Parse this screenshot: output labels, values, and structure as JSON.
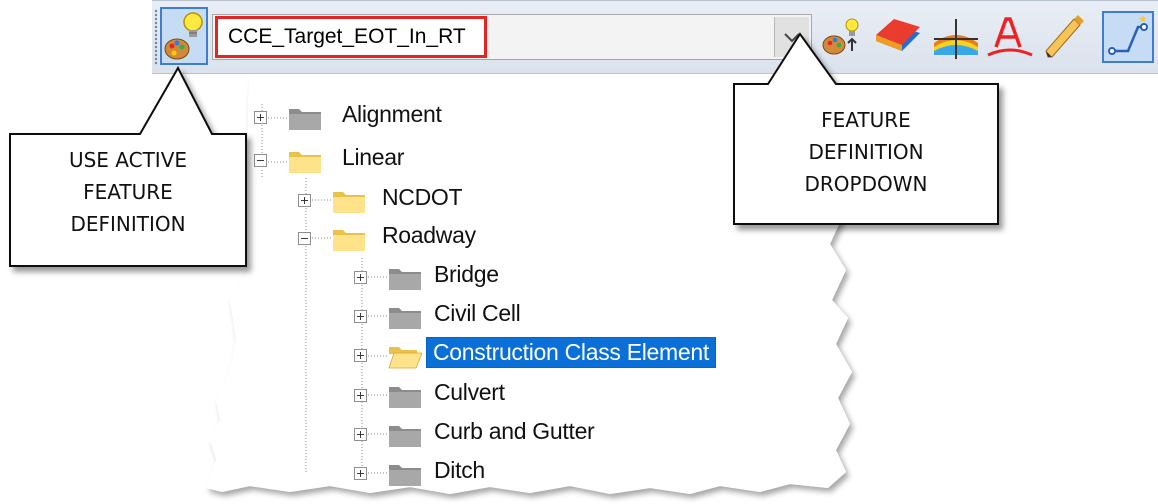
{
  "toolbar": {
    "feature_definition_value": "CCE_Target_EOT_In_RT",
    "icons": [
      "use-active-feature-icon",
      "dropdown-arrow-icon",
      "feature-settings-icon",
      "surface-icon",
      "cross-section-icon",
      "text-annotation-icon",
      "pencil-icon",
      "element-select-icon"
    ]
  },
  "tree": {
    "items": [
      {
        "label": "Alignment",
        "level": 0,
        "expanded": false,
        "folder": "gray"
      },
      {
        "label": "Linear",
        "level": 0,
        "expanded": true,
        "folder": "yellow"
      },
      {
        "label": "NCDOT",
        "level": 1,
        "expanded": false,
        "folder": "yellow"
      },
      {
        "label": "Roadway",
        "level": 1,
        "expanded": true,
        "folder": "yellow"
      },
      {
        "label": "Bridge",
        "level": 2,
        "expanded": false,
        "folder": "gray"
      },
      {
        "label": "Civil Cell",
        "level": 2,
        "expanded": false,
        "folder": "gray"
      },
      {
        "label": "Construction Class Element",
        "level": 2,
        "expanded": false,
        "folder": "yellow-open",
        "selected": true
      },
      {
        "label": "Culvert",
        "level": 2,
        "expanded": false,
        "folder": "gray"
      },
      {
        "label": "Curb and Gutter",
        "level": 2,
        "expanded": false,
        "folder": "gray"
      },
      {
        "label": "Ditch",
        "level": 2,
        "expanded": false,
        "folder": "gray"
      }
    ]
  },
  "callouts": {
    "left": {
      "line1": "USE ACTIVE",
      "line2": "FEATURE",
      "line3": "DEFINITION"
    },
    "right": {
      "line1": "FEATURE",
      "line2": "DEFINITION",
      "line3": "DROPDOWN"
    }
  },
  "colors": {
    "selection": "#0a6fd6",
    "highlight_frame": "#e52424",
    "button_active": "#c6dcf4"
  }
}
